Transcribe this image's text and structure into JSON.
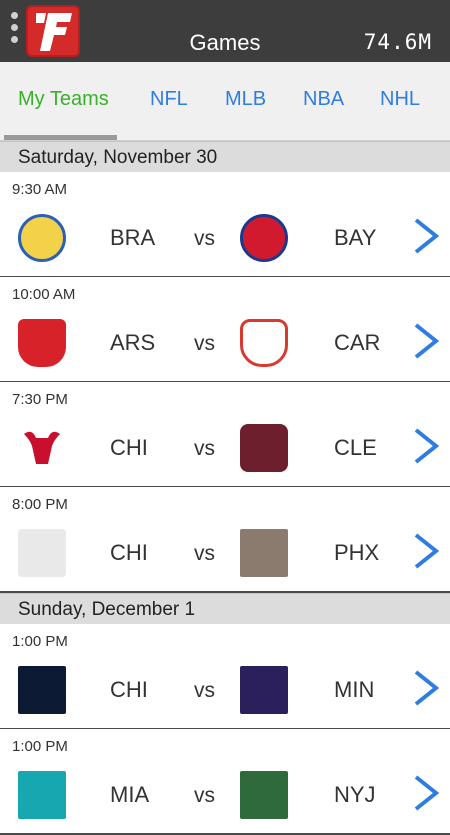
{
  "appbar": {
    "title": "Games",
    "status_readout": "74.6M",
    "logo_icon": "fanatics-f-logo",
    "colors": {
      "background": "#3d3d3d",
      "logo": "#d42a2a"
    }
  },
  "tabs": [
    {
      "label": "My Teams",
      "active": true
    },
    {
      "label": "NFL",
      "active": false
    },
    {
      "label": "MLB",
      "active": false
    },
    {
      "label": "NBA",
      "active": false
    },
    {
      "label": "NHL",
      "active": false
    }
  ],
  "days": [
    {
      "label": "Saturday, November 30",
      "games": [
        {
          "time": "9:30 AM",
          "home": "BRA",
          "vs": "vs",
          "away": "BAY",
          "home_logo": "braunschweig-crest-icon",
          "away_logo": "bayern-munich-crest-icon"
        },
        {
          "time": "10:00 AM",
          "home": "ARS",
          "vs": "vs",
          "away": "CAR",
          "home_logo": "arsenal-crest-icon",
          "away_logo": "cardiff-crest-icon"
        },
        {
          "time": "7:30 PM",
          "home": "CHI",
          "vs": "vs",
          "away": "CLE",
          "home_logo": "chicago-bulls-logo-icon",
          "away_logo": "cleveland-cavaliers-logo-icon"
        },
        {
          "time": "8:00 PM",
          "home": "CHI",
          "vs": "vs",
          "away": "PHX",
          "home_logo": "chicago-blackhawks-champions-icon",
          "away_logo": "phoenix-coyotes-logo-icon"
        }
      ]
    },
    {
      "label": "Sunday, December 1",
      "games": [
        {
          "time": "1:00 PM",
          "home": "CHI",
          "vs": "vs",
          "away": "MIN",
          "home_logo": "chicago-bears-logo-icon",
          "away_logo": "minnesota-vikings-logo-icon"
        },
        {
          "time": "1:00 PM",
          "home": "MIA",
          "vs": "vs",
          "away": "NYJ",
          "home_logo": "miami-dolphins-logo-icon",
          "away_logo": "new-york-jets-logo-icon"
        }
      ]
    }
  ],
  "chevron_icon": "chevron-right-icon",
  "accent_colors": {
    "active_tab": "#3ab02a",
    "tab": "#2f7de1",
    "chevron": "#2f7de1"
  }
}
